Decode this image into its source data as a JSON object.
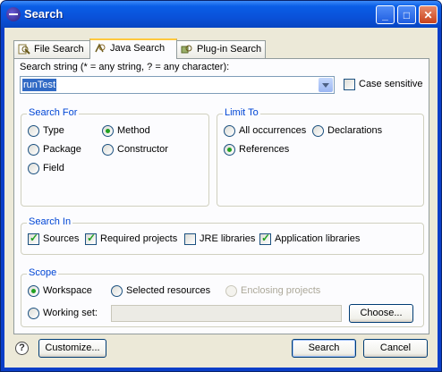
{
  "window": {
    "title": "Search"
  },
  "tabs": [
    {
      "label": "File Search",
      "icon": "file-search-icon",
      "active": false
    },
    {
      "label": "Java Search",
      "icon": "java-search-icon",
      "active": true
    },
    {
      "label": "Plug-in Search",
      "icon": "plugin-search-icon",
      "active": false
    }
  ],
  "search_string": {
    "label": "Search string (* = any string, ? = any character):",
    "value": "runTest",
    "case_sensitive_label": "Case sensitive",
    "case_sensitive": false
  },
  "search_for": {
    "title": "Search For",
    "options": {
      "type": "Type",
      "package": "Package",
      "field": "Field",
      "method": "Method",
      "constructor": "Constructor"
    },
    "selected": "Method"
  },
  "limit_to": {
    "title": "Limit To",
    "options": {
      "all": "All occurrences",
      "declarations": "Declarations",
      "references": "References"
    },
    "selected": "References"
  },
  "search_in": {
    "title": "Search In",
    "sources": "Sources",
    "required_projects": "Required projects",
    "jre_libraries": "JRE libraries",
    "application_libraries": "Application libraries",
    "checked": {
      "sources": true,
      "required_projects": true,
      "jre_libraries": false,
      "application_libraries": true
    }
  },
  "scope": {
    "title": "Scope",
    "workspace": "Workspace",
    "selected_resources": "Selected resources",
    "enclosing_projects": "Enclosing projects",
    "working_set": "Working set:",
    "working_set_value": "",
    "choose_button": "Choose...",
    "selected": "Workspace"
  },
  "footer": {
    "customize_button": "Customize...",
    "search_button": "Search",
    "cancel_button": "Cancel",
    "help_glyph": "?"
  },
  "colors": {
    "title_bar": "#0a52da",
    "group_title": "#0046d5",
    "radio_dot": "#21a121",
    "selection": "#316ac5"
  }
}
